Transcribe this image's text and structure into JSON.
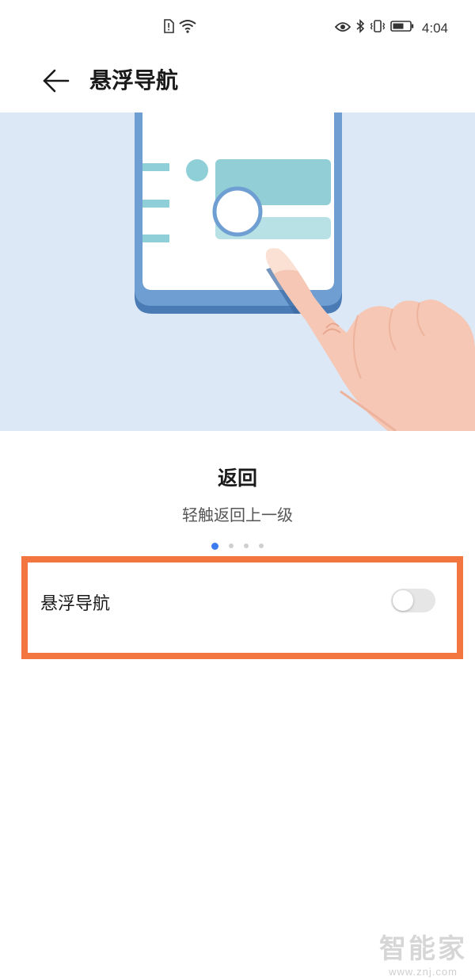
{
  "status_bar": {
    "time": "4:04",
    "icons": [
      "sim-alert-icon",
      "wifi-icon",
      "eye-comfort-icon",
      "bluetooth-icon",
      "vibrate-icon",
      "battery-icon"
    ]
  },
  "header": {
    "title": "悬浮导航",
    "back_icon": "arrow-left-icon"
  },
  "tutorial": {
    "title": "返回",
    "description": "轻触返回上一级",
    "page_count": 4,
    "active_page": 1
  },
  "setting": {
    "label": "悬浮导航",
    "toggle_on": false
  },
  "colors": {
    "accent": "#3c7cf0",
    "highlight": "#f37641",
    "illustration_bg": "#dce8f6"
  },
  "watermark": {
    "title": "智能家",
    "url": "www.znj.com"
  }
}
